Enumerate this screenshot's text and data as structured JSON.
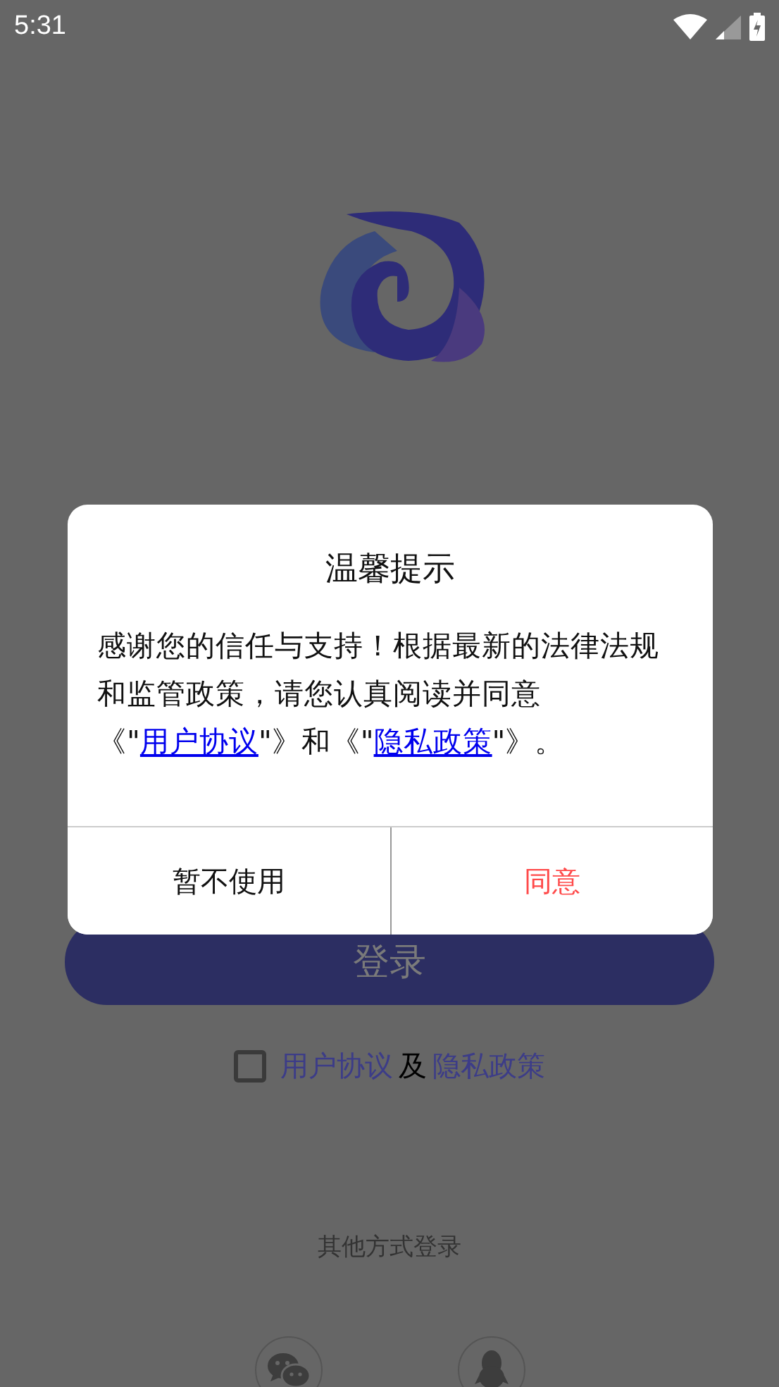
{
  "status_bar": {
    "time": "5:31"
  },
  "login_button": {
    "label": "登录"
  },
  "agreement": {
    "checked": false,
    "parts": [
      {
        "kind": "link",
        "text": "用户协议"
      },
      {
        "kind": "text",
        "text": "及"
      },
      {
        "kind": "link",
        "text": "隐私政策"
      }
    ]
  },
  "other_login": {
    "label": "其他方式登录",
    "methods": [
      {
        "kind": "wechat"
      },
      {
        "kind": "qq"
      }
    ]
  },
  "dialog": {
    "title": "温馨提示",
    "message": [
      {
        "kind": "text",
        "text": "感谢您的信任与支持！根据最新的法律法规和监管政策，请您认真阅读并同意《\""
      },
      {
        "kind": "link",
        "text": "用户协议"
      },
      {
        "kind": "text",
        "text": "\"》和《\""
      },
      {
        "kind": "link",
        "text": "隐私政策"
      },
      {
        "kind": "text",
        "text": "\"》。"
      }
    ],
    "buttons": [
      {
        "label": "暂不使用",
        "kind": "cancel"
      },
      {
        "label": "同意",
        "kind": "confirm"
      }
    ]
  }
}
